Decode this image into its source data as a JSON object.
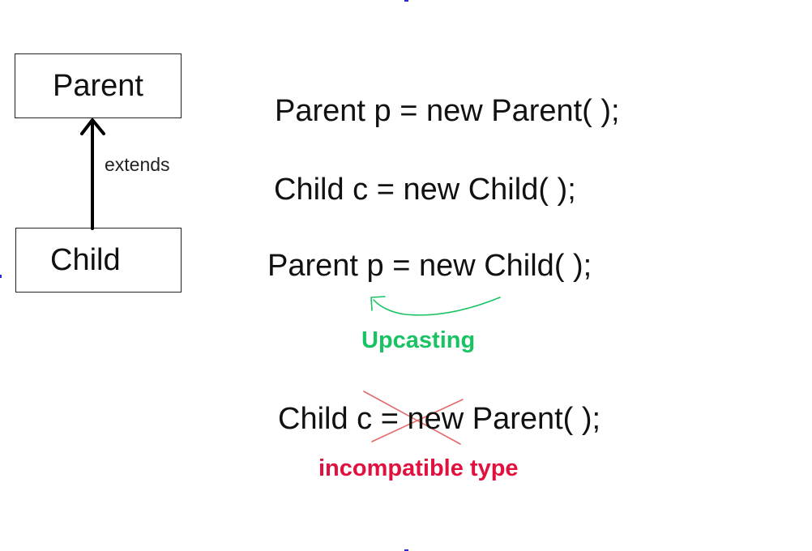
{
  "diagram": {
    "parent_class": "Parent",
    "child_class": "Child",
    "relationship": "extends"
  },
  "code": {
    "line1": "Parent p = new Parent( );",
    "line2": "Child c = new Child( );",
    "line3": "Parent p = new Child( );",
    "line4": "Child c = new Parent( );"
  },
  "annotations": {
    "upcasting": "Upcasting",
    "incompatible": "incompatible type"
  },
  "colors": {
    "arrow": "#000000",
    "upcasting": "#19c363",
    "incompatible": "#e0113f",
    "cross": "#e36a6a"
  }
}
